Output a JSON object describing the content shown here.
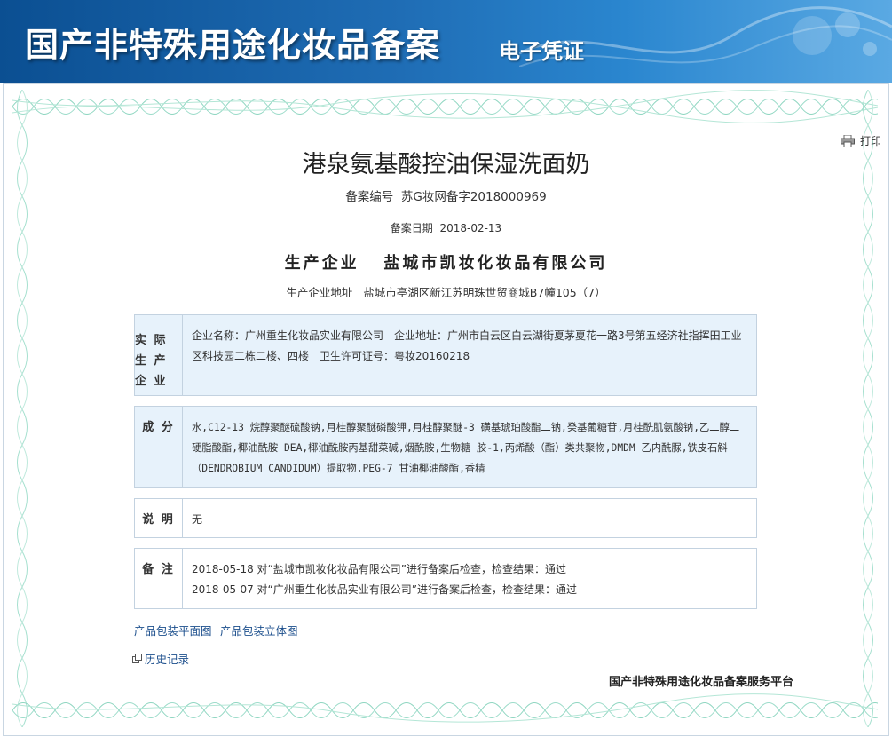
{
  "banner": {
    "title": "国产非特殊用途化妆品备案",
    "subtitle": "电子凭证"
  },
  "toolbar": {
    "print_label": "打印"
  },
  "product": {
    "name": "港泉氨基酸控油保湿洗面奶",
    "record_no_label": "备案编号",
    "record_no": "苏G妆网备字2018000969",
    "record_date_label": "备案日期",
    "record_date": "2018-02-13",
    "producer_label": "生产企业",
    "producer": "盐城市凯妆化妆品有限公司",
    "producer_addr_label": "生产企业地址",
    "producer_addr": "盐城市亭湖区新江苏明珠世贸商城B7幢105（7）"
  },
  "sections": {
    "actual_producer": {
      "label": "实际生产企业",
      "label_lines": [
        "实 际",
        "生 产",
        "企 业"
      ],
      "content": "企业名称：广州重生化妆品实业有限公司　企业地址：广州市白云区白云湖街夏茅夏花一路3号第五经济社指挥田工业区科技园二栋二楼、四楼　卫生许可证号：粤妆20160218"
    },
    "ingredients": {
      "label": "成 分",
      "content": "水,C12-13 烷醇聚醚硫酸钠,月桂醇聚醚磷酸钾,月桂醇聚醚-3 磺基琥珀酸酯二钠,癸基葡糖苷,月桂酰肌氨酸钠,乙二醇二硬脂酸酯,椰油酰胺 DEA,椰油酰胺丙基甜菜碱,烟酰胺,生物糖 胶-1,丙烯酸（酯）类共聚物,DMDM 乙内酰脲,铁皮石斛（DENDROBIUM CANDIDUM）提取物,PEG-7 甘油椰油酸酯,香精"
    },
    "notes": {
      "label": "说 明",
      "content": "无"
    },
    "remarks": {
      "label": "备 注",
      "lines": [
        "2018-05-18 对“盐城市凯妆化妆品有限公司”进行备案后检查，检查结果：通过",
        "2018-05-07 对“广州重生化妆品实业有限公司”进行备案后检查，检查结果：通过"
      ]
    }
  },
  "links": {
    "flat_package": "产品包装平面图",
    "stereo_package": "产品包装立体图",
    "history": "历史记录"
  },
  "footer": {
    "platform": "国产非特殊用途化妆品备案服务平台"
  },
  "colors": {
    "banner": "#1f6db5",
    "box_fill": "#e7f2fb",
    "link": "#1b4e8c",
    "guilloche": "#7fcfb8"
  }
}
